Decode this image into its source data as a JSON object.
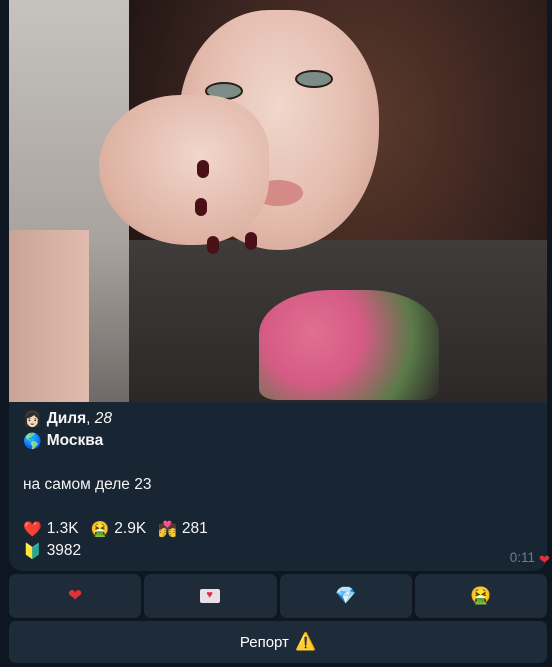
{
  "message": {
    "photo_alt": "",
    "caption": {
      "name_emoji": "👩🏻",
      "name": "Диля",
      "age_sep": ", ",
      "age": "28",
      "city_emoji": "🌎",
      "city": "Москва",
      "bio": "на самом деле 23",
      "stats": [
        {
          "emoji": "❤️",
          "value": "1.3K"
        },
        {
          "emoji": "🤮",
          "value": "2.9K"
        },
        {
          "emoji": "💏",
          "value": "281"
        }
      ],
      "rank_emoji": "🔰",
      "rank_value": "3982"
    },
    "time": "0:11",
    "time_reaction": "❤"
  },
  "keyboard": {
    "row1": [
      {
        "id": "like",
        "icon": "❤"
      },
      {
        "id": "message",
        "icon": "💌"
      },
      {
        "id": "super",
        "icon": "💎"
      },
      {
        "id": "dislike",
        "icon": "🤮"
      }
    ],
    "report_label": "Репорт",
    "report_icon": "⚠️"
  },
  "colors": {
    "background": "#0e1621",
    "bubble": "#182533",
    "button": "#1e2c3a",
    "meta_text": "#6d7f8f"
  }
}
